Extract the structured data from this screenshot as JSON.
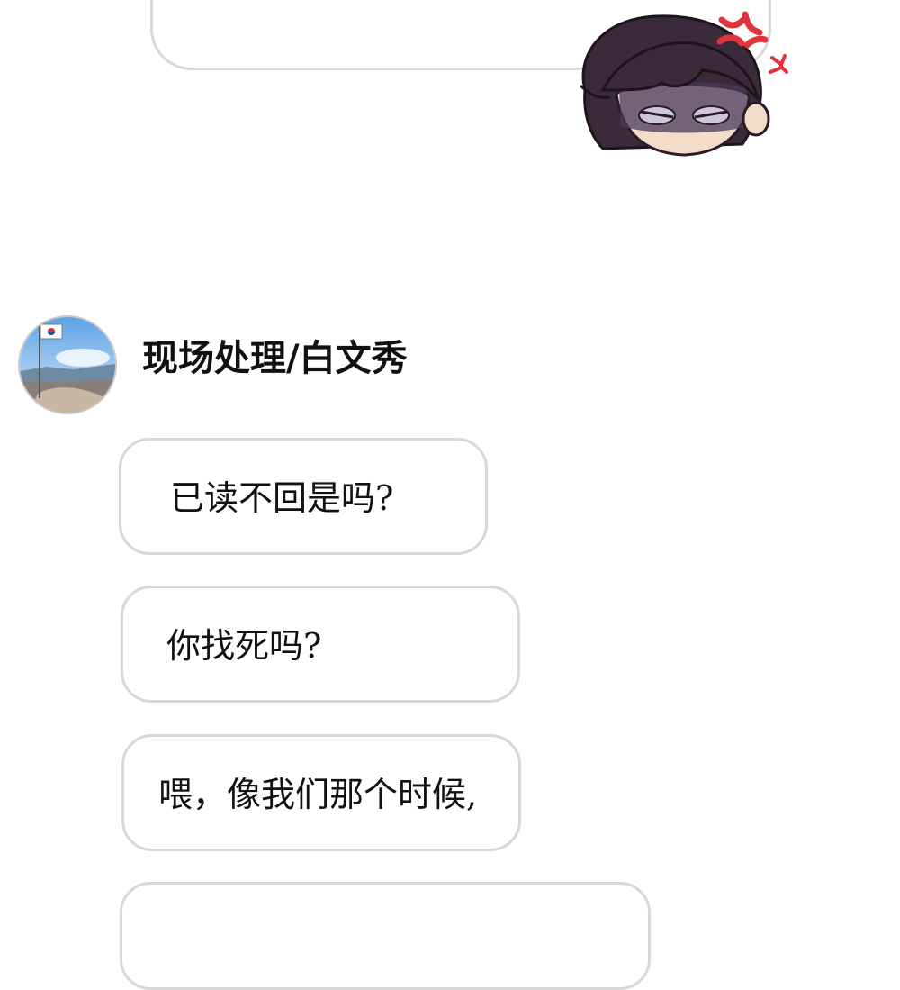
{
  "sender": {
    "name": "现场处理/白文秀",
    "avatar_icon": "mountain-summit-flag-photo"
  },
  "sticker": {
    "icon": "angry-chibi-face-icon",
    "anger_mark_color": "#e0333b"
  },
  "messages": [
    {
      "text": "已读不回是吗?"
    },
    {
      "text": "你找死吗?"
    },
    {
      "text": "喂，像我们那个时候,"
    },
    {
      "text": ""
    }
  ],
  "colors": {
    "bubble_border": "#d8d8d8",
    "background": "#ffffff",
    "text": "#111111"
  }
}
